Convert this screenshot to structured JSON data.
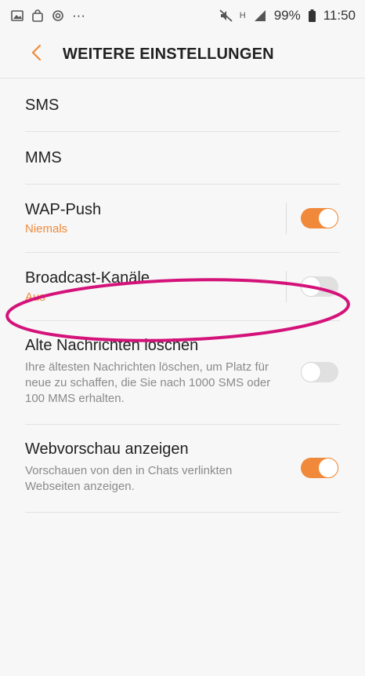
{
  "status_bar": {
    "more": "···",
    "signal_h": "H",
    "battery": "99%",
    "time": "11:50"
  },
  "header": {
    "title": "WEITERE EINSTELLUNGEN"
  },
  "settings": {
    "sms": {
      "title": "SMS"
    },
    "mms": {
      "title": "MMS"
    },
    "wap_push": {
      "title": "WAP-Push",
      "value": "Niemals",
      "enabled": true
    },
    "broadcast": {
      "title": "Broadcast-Kanäle",
      "value": "Aus",
      "enabled": false
    },
    "delete_old": {
      "title": "Alte Nachrichten löschen",
      "description": "Ihre ältesten Nachrichten löschen, um Platz für neue zu schaffen, die Sie nach 1000 SMS oder 100 MMS erhalten.",
      "enabled": false
    },
    "web_preview": {
      "title": "Webvorschau anzeigen",
      "description": "Vorschauen von den in Chats verlinkten Webseiten anzeigen.",
      "enabled": true
    }
  },
  "colors": {
    "accent": "#f08a3a",
    "annotation": "#d4137a"
  }
}
